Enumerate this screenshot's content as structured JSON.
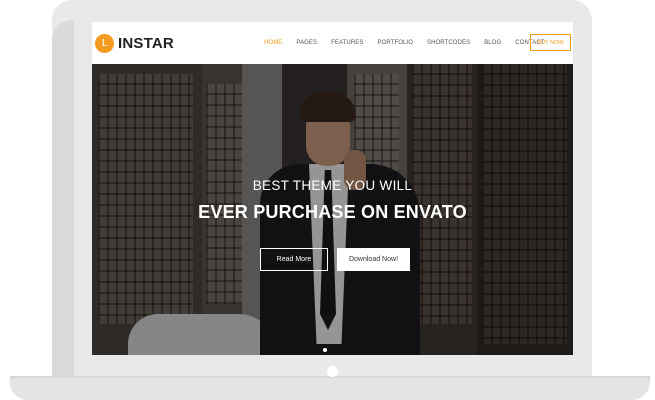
{
  "logo": {
    "mark": "L",
    "name": "INSTAR"
  },
  "nav": {
    "items": [
      {
        "label": "HOME"
      },
      {
        "label": "PAGES"
      },
      {
        "label": "FEATURES"
      },
      {
        "label": "PORTFOLIO"
      },
      {
        "label": "SHORTCODES"
      },
      {
        "label": "BLOG"
      },
      {
        "label": "CONTACT"
      }
    ],
    "active_index": 0,
    "cta": "BUY NOW"
  },
  "hero": {
    "subtitle": "BEST THEME YOU WILL",
    "title": "EVER PURCHASE ON ENVATO",
    "primary_button": "Read More",
    "secondary_button": "Download Now!",
    "slide_count": 1,
    "active_slide": 1
  },
  "colors": {
    "accent": "#f39c1f",
    "frame": "#e9e9e9",
    "text_dark": "#222222"
  }
}
